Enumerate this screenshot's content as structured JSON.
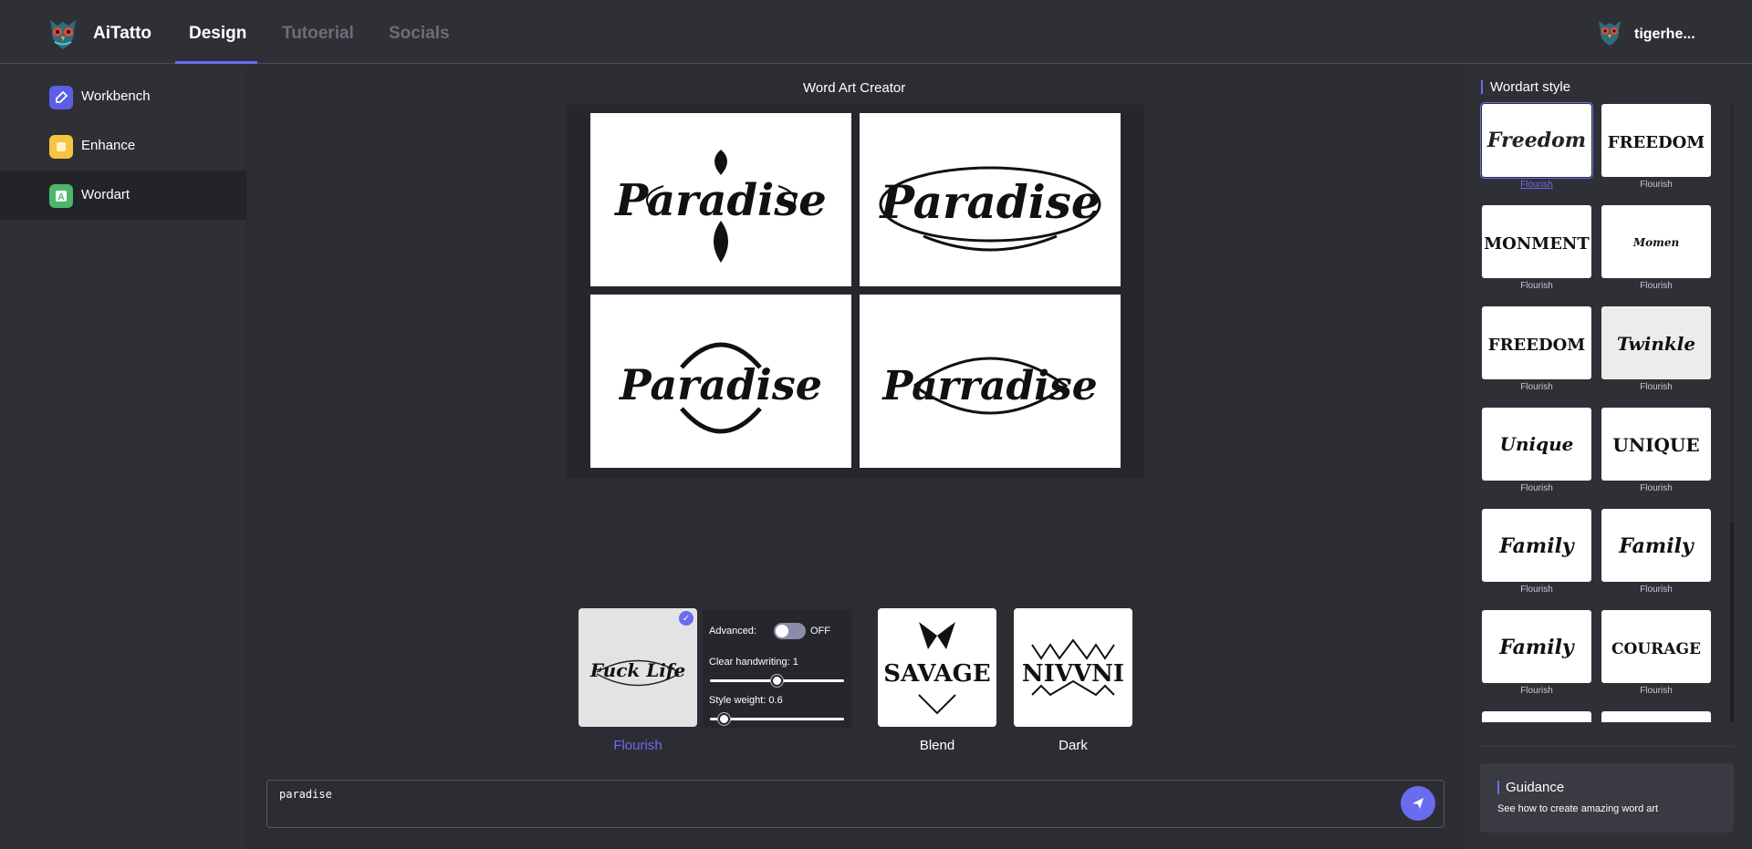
{
  "header": {
    "brand": "AiTatto",
    "tabs": [
      {
        "label": "Design",
        "active": true
      },
      {
        "label": "Tutoerial",
        "active": false
      },
      {
        "label": "Socials",
        "active": false
      }
    ],
    "user_name": "tigerhe..."
  },
  "sidebar": {
    "items": [
      {
        "label": "Workbench",
        "icon": "brush-icon",
        "color": "#5b5fe6",
        "active": false
      },
      {
        "label": "Enhance",
        "icon": "enhance-icon",
        "color": "#f6c343",
        "active": false
      },
      {
        "label": "Wordart",
        "icon": "letter-a-icon",
        "color": "#4cb86a",
        "active": true
      }
    ]
  },
  "main": {
    "title": "Word Art Creator",
    "results": [
      {
        "text": "Paradise"
      },
      {
        "text": "Paradise"
      },
      {
        "text": "Paradise"
      },
      {
        "text": "Parradise"
      }
    ],
    "styles": [
      {
        "label": "Flourish",
        "art_text": "Fuck Life",
        "selected": true
      },
      {
        "label": "Blend",
        "art_text": "SAVAGE",
        "selected": false
      },
      {
        "label": "Dark",
        "art_text": "NIVVNI",
        "selected": false
      }
    ],
    "advanced": {
      "label": "Advanced:",
      "toggle_state": "OFF",
      "clear_handwriting_label": "Clear handwriting: 1",
      "clear_handwriting_value": 0.5,
      "style_weight_label": "Style weight: 0.6",
      "style_weight_value": 0.06
    },
    "prompt": {
      "value": "paradise"
    }
  },
  "right_panel": {
    "title": "Wordart style",
    "thumbnails": [
      {
        "text": "Freedom",
        "label": "Flourish",
        "selected": true
      },
      {
        "text": "FREEDOM",
        "label": "Flourish",
        "selected": false
      },
      {
        "text": "MONMENT",
        "label": "Flourish",
        "selected": false
      },
      {
        "text": "Momen",
        "label": "Flourish",
        "selected": false
      },
      {
        "text": "FREEDOM",
        "label": "Flourish",
        "selected": false
      },
      {
        "text": "Twinkle",
        "label": "Flourish",
        "selected": false
      },
      {
        "text": "Unique",
        "label": "Flourish",
        "selected": false
      },
      {
        "text": "UNIQUE",
        "label": "Flourish",
        "selected": false
      },
      {
        "text": "Family",
        "label": "Flourish",
        "selected": false
      },
      {
        "text": "Family",
        "label": "Flourish",
        "selected": false
      },
      {
        "text": "Family",
        "label": "Flourish",
        "selected": false
      },
      {
        "text": "COURAGE",
        "label": "Flourish",
        "selected": false
      }
    ],
    "guidance": {
      "title": "Guidance",
      "subtitle": "See how to create amazing word art"
    }
  },
  "colors": {
    "accent": "#6a6cf0",
    "background": "#2c2d33"
  }
}
